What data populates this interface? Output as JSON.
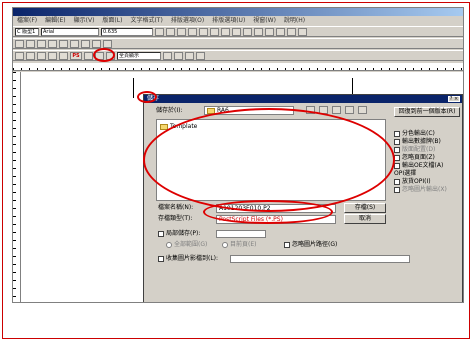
{
  "menu": [
    "檔案(F)",
    "編輯(E)",
    "顯示(V)",
    "版面(L)",
    "文字格式(T)",
    "排版選項(O)",
    "排版選項(U)",
    "視窗(W)",
    "說明(H)"
  ],
  "toolbar": {
    "style": "C 版型1",
    "font": "Arial",
    "size": "0.635",
    "ps_label": "PS",
    "page_label": "全頁顯示"
  },
  "dialog": {
    "title": "儲存",
    "save_in_label": "儲存於(I):",
    "save_in_value": "RA6",
    "restore_button": "回復到前一個版本(R)",
    "folder_item": "Template",
    "filename_label": "檔案名稱(N):",
    "filename_value": "A101203E010.P2",
    "filetype_label": "存檔類型(T):",
    "filetype_value": "PostScript Files (*.PS)",
    "save_button": "存檔(S)",
    "cancel_button": "取消",
    "options": [
      "分色輸出(C)",
      "輸出數據牌(B)",
      "版面配置(D)",
      "忽略頁面(Z)",
      "輸出OE文檔(A)"
    ],
    "opi_label": "OPI選擇",
    "opi_options": [
      "放貨OPI(I)",
      "忽略圖片輸出(X)"
    ],
    "preview_label": "局部儲存(P):",
    "radio_labels": [
      "全部範圍(G)",
      "目前頁(E)"
    ],
    "ignore_picture_path": "忽略圖片路徑(G)",
    "collect_label": "收集圖片影檔到(L):"
  }
}
